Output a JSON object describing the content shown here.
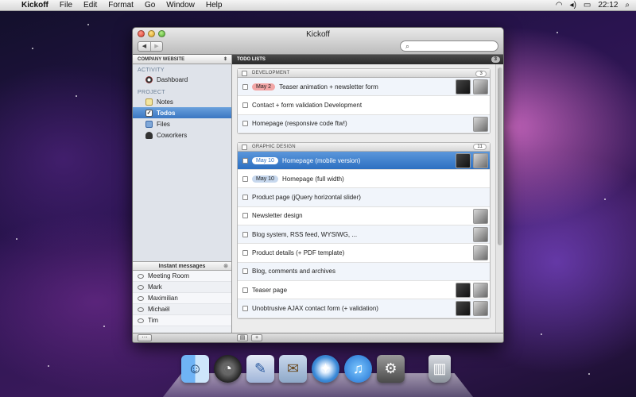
{
  "menubar": {
    "app_name": "Kickoff",
    "items": [
      "File",
      "Edit",
      "Format",
      "Go",
      "Window",
      "Help"
    ],
    "clock": "22:12"
  },
  "window": {
    "title": "Kickoff"
  },
  "sidebar": {
    "project_select": "COMPANY WEBSITE",
    "activity_heading": "ACTIVITY",
    "activity_items": [
      {
        "label": "Dashboard"
      }
    ],
    "project_heading": "PROJECT",
    "project_items": [
      {
        "label": "Notes"
      },
      {
        "label": "Todos",
        "selected": true
      },
      {
        "label": "Files"
      },
      {
        "label": "Coworkers"
      }
    ]
  },
  "instant_messages": {
    "heading": "Instant messages",
    "items": [
      "Meeting Room",
      "Mark",
      "Maximilian",
      "Michaël",
      "Tim"
    ]
  },
  "main": {
    "heading": "TODO LISTS",
    "count": "3",
    "groups": [
      {
        "name": "DEVELOPMENT",
        "count": "3",
        "tasks": [
          {
            "badge": "May 2",
            "badge_style": "red",
            "text": "Teaser animation + newsletter form",
            "avatars": 2
          },
          {
            "badge": "",
            "text": "Contact + form validation Development",
            "avatars": 0
          },
          {
            "badge": "",
            "text": "Homepage (responsive code ftw!)",
            "avatars": 1
          }
        ]
      },
      {
        "name": "GRAPHIC DESIGN",
        "count": "11",
        "tasks": [
          {
            "badge": "May 10",
            "text": "Homepage (mobile version)",
            "avatars": 2,
            "selected": true
          },
          {
            "badge": "May 10",
            "text": "Homepage (full width)",
            "avatars": 0
          },
          {
            "badge": "",
            "text": "Product page (jQuery horizontal slider)",
            "avatars": 0
          },
          {
            "badge": "",
            "text": "Newsletter design",
            "avatars": 1
          },
          {
            "badge": "",
            "text": "Blog system, RSS feed, WYSIWG, ...",
            "avatars": 1
          },
          {
            "badge": "",
            "text": "Product details (+ PDF template)",
            "avatars": 1
          },
          {
            "badge": "",
            "text": "Blog, comments and archives",
            "avatars": 0
          },
          {
            "badge": "",
            "text": "Teaser page",
            "avatars": 2
          },
          {
            "badge": "",
            "text": "Unobtrusive AJAX contact form (+ validation)",
            "avatars": 2
          }
        ]
      }
    ]
  },
  "dock": [
    "finder-icon",
    "dashboard-icon",
    "pages-icon",
    "mail-icon",
    "safari-icon",
    "itunes-icon",
    "system-preferences-icon",
    "trash-icon"
  ]
}
